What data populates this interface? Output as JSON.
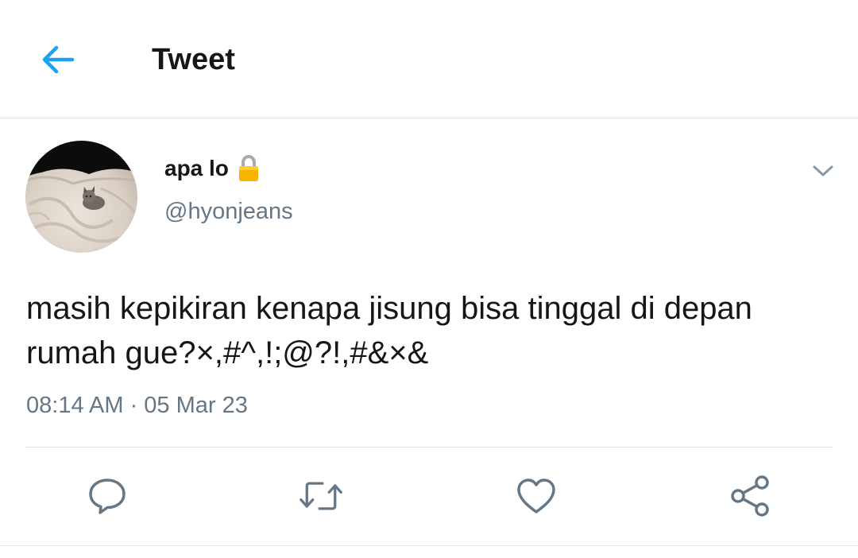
{
  "header": {
    "title": "Tweet",
    "back_icon": "arrow-left-icon",
    "accent_color": "#1da1f2"
  },
  "author": {
    "display_name": "apa lo",
    "handle": "@hyonjeans",
    "protected_icon": "lock-icon",
    "menu_icon": "chevron-down-icon",
    "avatar": "cat-on-bedsheet-photo"
  },
  "tweet": {
    "text": "masih kepikiran kenapa jisung bisa tinggal di depan rumah gue?×,#^,!;@?!,#&×&",
    "timestamp": "08:14 AM · 05 Mar 23"
  },
  "actions": [
    {
      "icon": "reply-icon"
    },
    {
      "icon": "retweet-icon"
    },
    {
      "icon": "like-icon"
    },
    {
      "icon": "share-icon"
    }
  ],
  "colors": {
    "text_primary": "#14171a",
    "text_secondary": "#657786",
    "icon_gray": "#657786",
    "divider": "#dfe3e6"
  }
}
